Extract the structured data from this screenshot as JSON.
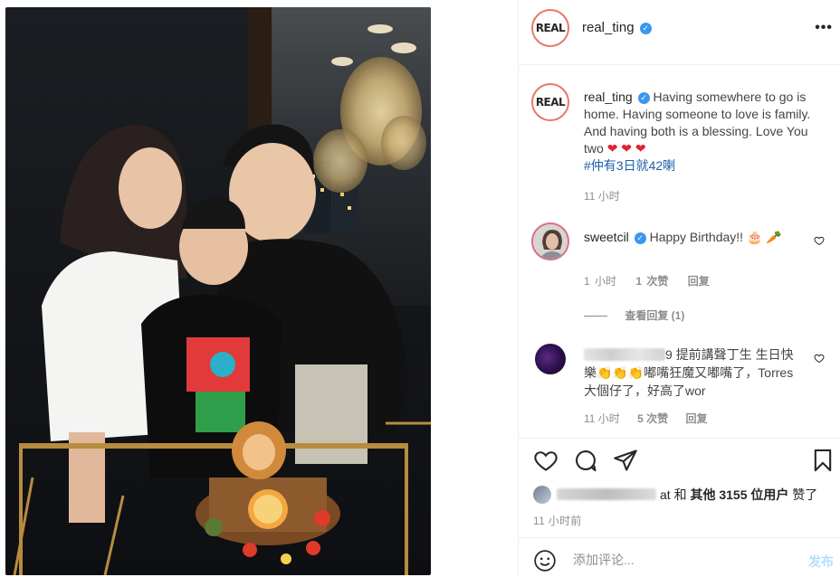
{
  "post": {
    "username": "real_ting",
    "avatar_logo_text": "REAL",
    "more_glyph": "•••"
  },
  "caption": {
    "username": "real_ting",
    "text": "Having somewhere to go is home. Having someone to love is family. And having both is a blessing. Love You two",
    "hearts": "❤ ❤ ❤",
    "hashtag": "#仲有3日就42喇",
    "time": "11 小时"
  },
  "comments": [
    {
      "username": "sweetcil",
      "text": "Happy Birthday!! 🎂 🥕",
      "time": "1 小时",
      "likes": "1 次赞",
      "reply": "回复",
      "view_replies": "查看回复 (1)"
    },
    {
      "username_visible_suffix": "9",
      "text_line1": "提前講聲丁生 生日快樂",
      "claps": "👏👏👏",
      "text_line2": "嘟嘴狂魔又嘟嘴了，Torres大個仔了，好高了wor",
      "time": "11 小时",
      "likes": "5 次赞",
      "reply": "回复"
    }
  ],
  "likes_summary": {
    "user_suffix": "at",
    "and": "和",
    "others": "其他 3155 位用户",
    "liked": "赞了"
  },
  "post_time": "11 小时前",
  "add_comment": {
    "placeholder": "添加评论...",
    "post_label": "发布"
  },
  "icons": {
    "like": "heart-outline-icon",
    "comment": "comment-bubble-icon",
    "share": "paper-plane-icon",
    "save": "bookmark-icon",
    "emoji": "smiley-icon",
    "verified": "verified-badge-icon"
  },
  "colors": {
    "verified": "#3897f0",
    "hashtag": "#1d5fa8",
    "heart_red": "#e0212f",
    "meta_gray": "#8e8e8e",
    "post_button_disabled": "#b2dffc"
  }
}
